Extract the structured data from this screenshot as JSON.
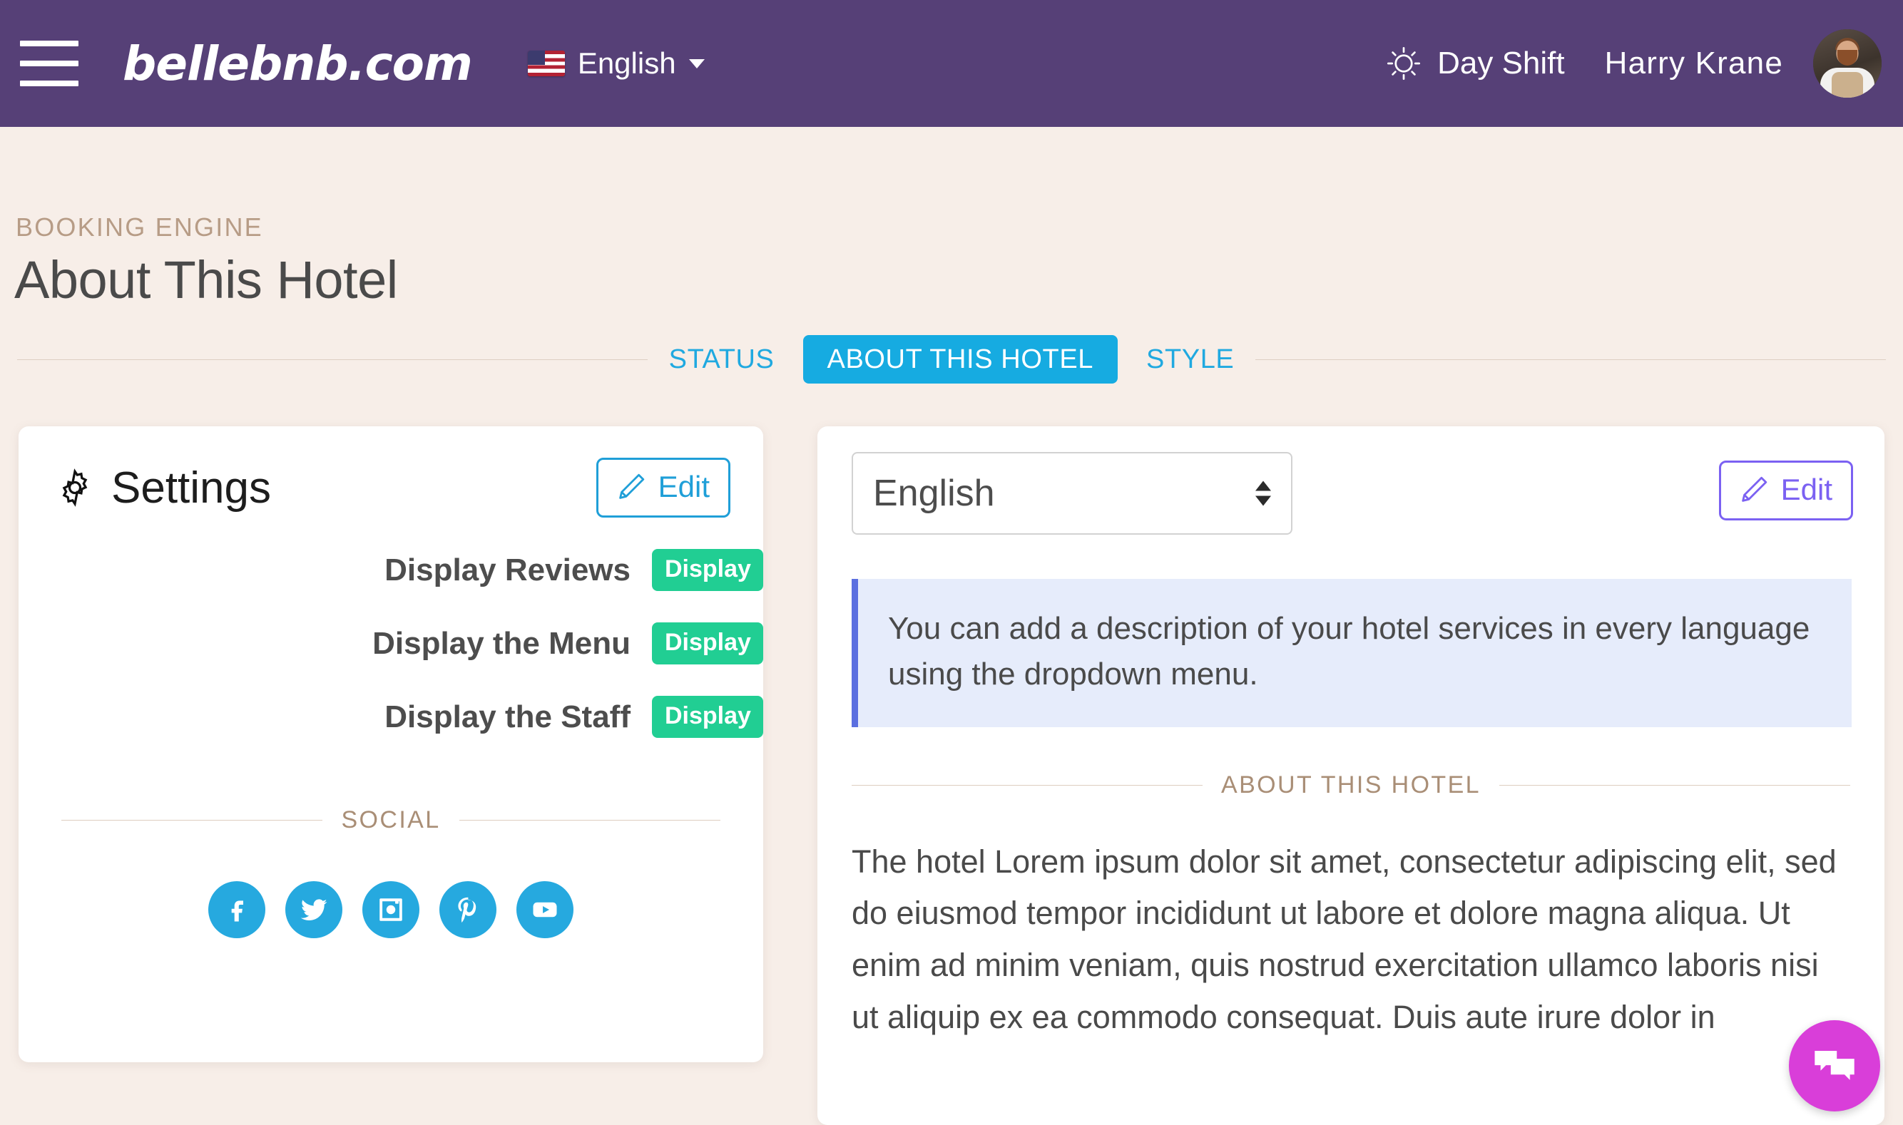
{
  "topbar": {
    "menu_icon": "hamburger-icon",
    "brand": "bellebnb.com",
    "language": "English",
    "flag_icon": "us-flag-icon",
    "caret_icon": "chevron-down-icon",
    "shift_label": "Day Shift",
    "shift_icon": "sun-icon",
    "user_name": "Harry Krane",
    "avatar_icon": "user-avatar",
    "bg_color": "#564077"
  },
  "page": {
    "breadcrumb": "BOOKING ENGINE",
    "title": "About This Hotel",
    "background": "#F7EEE8"
  },
  "tabs": [
    {
      "label": "STATUS",
      "active": false
    },
    {
      "label": "ABOUT THIS HOTEL",
      "active": true
    },
    {
      "label": "STYLE",
      "active": false
    }
  ],
  "tab_colors": {
    "text": "#20A9E0",
    "active_bg": "#16ABE1",
    "active_text": "#FFFFFF"
  },
  "settings_card": {
    "icon": "gear-icon",
    "title": "Settings",
    "edit_label": "Edit",
    "edit_icon": "pencil-icon",
    "edit_color": "#1F9FD8",
    "rows": [
      {
        "label": "Display Reviews",
        "badge": "Display"
      },
      {
        "label": "Display the Menu",
        "badge": "Display"
      },
      {
        "label": "Display the Staff",
        "badge": "Display"
      }
    ],
    "badge_color": "#21CE93",
    "social_divider": "SOCIAL",
    "social": [
      {
        "name": "facebook-icon"
      },
      {
        "name": "twitter-icon"
      },
      {
        "name": "instagram-icon"
      },
      {
        "name": "pinterest-icon"
      },
      {
        "name": "youtube-icon"
      }
    ],
    "social_color": "#26A9DF"
  },
  "about_card": {
    "language_value": "English",
    "dropdown_icon": "updown-arrows-icon",
    "edit_label": "Edit",
    "edit_icon": "pencil-icon",
    "edit_color": "#7B61F2",
    "alert_text": "You can add a description of your hotel services in every language using the dropdown menu.",
    "alert_bg": "#E6ECFB",
    "alert_border": "#5B6FE0",
    "section_divider": "ABOUT THIS HOTEL",
    "body_text": "The hotel Lorem ipsum dolor sit amet, consectetur adipiscing elit, sed do eiusmod tempor incididunt ut labore et dolore magna aliqua. Ut enim ad minim veniam, quis nostrud exercitation ullamco laboris nisi ut aliquip ex ea commodo consequat. Duis aute irure dolor in"
  },
  "chat_widget": {
    "icon": "chat-bubbles-icon",
    "color": "#D93ED9"
  }
}
